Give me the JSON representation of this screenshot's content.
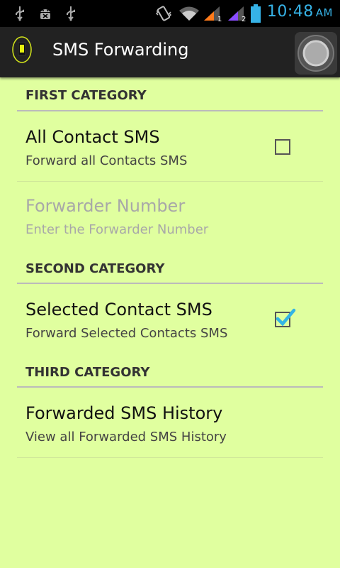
{
  "status_bar": {
    "icons": [
      "usb-icon",
      "android-debug-icon",
      "usb-icon",
      "vibrate-icon",
      "wifi-icon",
      "signal-1-icon",
      "signal-2-icon",
      "battery-icon"
    ],
    "sim1": "1",
    "sim2": "2",
    "time": "10:48",
    "ampm": "AM",
    "clock_color": "#36b2e6"
  },
  "action_bar": {
    "title": "SMS Forwarding",
    "app_icon": "sms-app-icon",
    "overflow_icon": "circle-button-icon"
  },
  "categories": [
    {
      "header": "FIRST CATEGORY",
      "items": [
        {
          "title": "All Contact SMS",
          "summary": "Forward all Contacts SMS",
          "checkbox": true,
          "checked": false,
          "enabled": true
        },
        {
          "title": "Forwarder Number",
          "summary": "Enter the Forwarder Number",
          "checkbox": false,
          "enabled": false
        }
      ]
    },
    {
      "header": "SECOND CATEGORY",
      "items": [
        {
          "title": "Selected Contact SMS",
          "summary": "Forward Selected Contacts SMS",
          "checkbox": true,
          "checked": true,
          "enabled": true
        }
      ]
    },
    {
      "header": "THIRD CATEGORY",
      "items": [
        {
          "title": "Forwarded SMS History",
          "summary": "View all Forwarded SMS History",
          "checkbox": false,
          "enabled": true
        }
      ]
    }
  ],
  "colors": {
    "background": "#e0ff9f",
    "action_bar": "#222222",
    "accent": "#33b5e5"
  }
}
